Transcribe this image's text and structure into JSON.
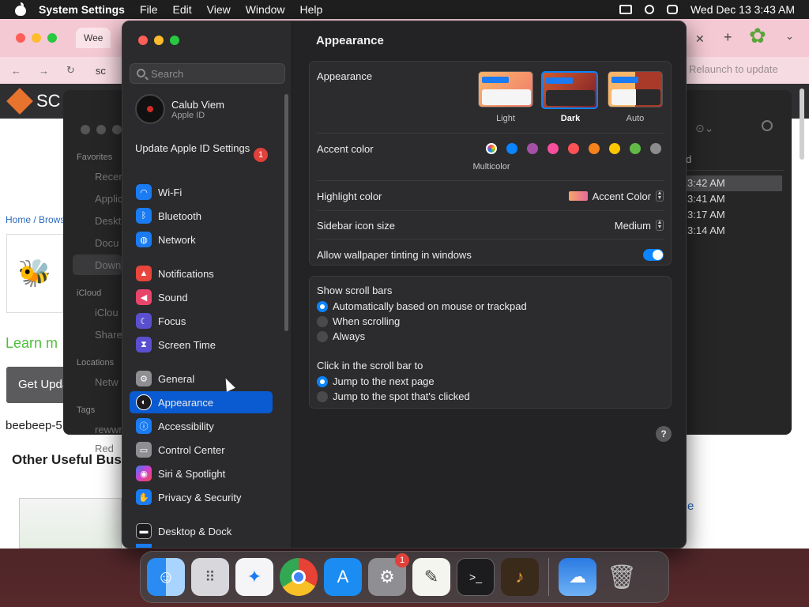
{
  "menubar": {
    "app_name": "System Settings",
    "menus": [
      "File",
      "Edit",
      "View",
      "Window",
      "Help"
    ],
    "datetime": "Wed Dec 13  3:43 AM"
  },
  "browser": {
    "tab_title": "Wee",
    "address_hint": "Relaunch to update",
    "address_partial": "sc",
    "site_logo_text": "SC",
    "breadcrumb": "Home / Brows",
    "learn_more": "Learn m",
    "get_update": "Get Upda",
    "beebeep": "beebeep-5",
    "other_useful": "Other Useful Bus",
    "right_link": "e"
  },
  "finder_behind": {
    "favorites_header": "Favorites",
    "favorites": [
      "Recen",
      "Applic",
      "Deskt",
      "Docu",
      "Down"
    ],
    "icloud_header": "iCloud",
    "icloud": [
      "iClou",
      "Share"
    ],
    "locations_header": "Locations",
    "locations": [
      "Netw"
    ],
    "tags_header": "Tags",
    "tags": [
      "rewwr",
      "Red"
    ],
    "column_header": "d",
    "times": [
      "3:42 AM",
      "3:41 AM",
      "3:17 AM",
      "3:14 AM"
    ]
  },
  "sidebar": {
    "search_placeholder": "Search",
    "account_name": "Calub Viem",
    "account_sub": "Apple ID",
    "update_label": "Update Apple ID Settings",
    "update_badge": "1",
    "items": [
      {
        "label": "Wi-Fi",
        "icon": "wifi-icon",
        "color": "#1a7bf2"
      },
      {
        "label": "Bluetooth",
        "icon": "bluetooth-icon",
        "color": "#1a7bf2"
      },
      {
        "label": "Network",
        "icon": "globe-icon",
        "color": "#1a7bf2"
      },
      {
        "label": "Notifications",
        "icon": "bell-icon",
        "color": "#e8453c"
      },
      {
        "label": "Sound",
        "icon": "speaker-icon",
        "color": "#e8456a"
      },
      {
        "label": "Focus",
        "icon": "moon-icon",
        "color": "#5a4fcf"
      },
      {
        "label": "Screen Time",
        "icon": "hourglass-icon",
        "color": "#5a4fcf"
      },
      {
        "label": "General",
        "icon": "gear-icon",
        "color": "#8e8e93"
      },
      {
        "label": "Appearance",
        "icon": "appearance-icon",
        "color": "#1c1c1e"
      },
      {
        "label": "Accessibility",
        "icon": "accessibility-icon",
        "color": "#1a7bf2"
      },
      {
        "label": "Control Center",
        "icon": "control-center-icon",
        "color": "#8e8e93"
      },
      {
        "label": "Siri & Spotlight",
        "icon": "siri-icon",
        "color": "#b03fcf"
      },
      {
        "label": "Privacy & Security",
        "icon": "hand-icon",
        "color": "#1a7bf2"
      },
      {
        "label": "Desktop & Dock",
        "icon": "dock-icon",
        "color": "#1c1c1e"
      }
    ]
  },
  "content": {
    "title": "Appearance",
    "appearance_label": "Appearance",
    "appearance_options": [
      "Light",
      "Dark",
      "Auto"
    ],
    "appearance_selected": "Dark",
    "accent_label": "Accent color",
    "accent_colors": [
      "#ff6bd8",
      "#0a84ff",
      "#a550a7",
      "#f74f9e",
      "#ff5257",
      "#f7821b",
      "#ffc600",
      "#62ba46",
      "#8c8c8c"
    ],
    "accent_selected_name": "Multicolor",
    "highlight_label": "Highlight color",
    "highlight_value": "Accent Color",
    "sidebar_icon_label": "Sidebar icon size",
    "sidebar_icon_value": "Medium",
    "tinting_label": "Allow wallpaper tinting in windows",
    "tinting_on": true,
    "scroll_header": "Show scroll bars",
    "scroll_options": [
      "Automatically based on mouse or trackpad",
      "When scrolling",
      "Always"
    ],
    "click_header": "Click in the scroll bar to",
    "click_options": [
      "Jump to the next page",
      "Jump to the spot that's clicked"
    ],
    "help": "?"
  },
  "dock": {
    "apps": [
      "finder-icon",
      "launchpad-icon",
      "safari-icon",
      "chrome-icon",
      "app-store-icon",
      "system-settings-icon",
      "textedit-icon",
      "terminal-icon",
      "garageband-icon",
      "weather-icon",
      "trash-icon"
    ],
    "settings_badge": "1"
  }
}
